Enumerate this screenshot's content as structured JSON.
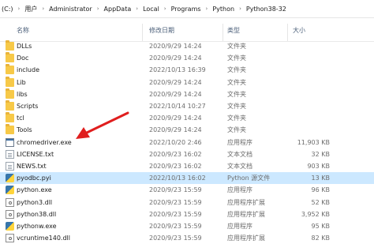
{
  "address_bar": {
    "crumbs": [
      "(C:)",
      "用户",
      "Administrator",
      "AppData",
      "Local",
      "Programs",
      "Python",
      "Python38-32"
    ]
  },
  "columns": {
    "name": "名称",
    "date": "修改日期",
    "type": "类型",
    "size": "大小"
  },
  "files": [
    {
      "name": "DLLs",
      "date": "2020/9/29 14:24",
      "type": "文件夹",
      "size": "",
      "icon": "folder-icon"
    },
    {
      "name": "Doc",
      "date": "2020/9/29 14:24",
      "type": "文件夹",
      "size": "",
      "icon": "folder-icon"
    },
    {
      "name": "include",
      "date": "2022/10/13 16:39",
      "type": "文件夹",
      "size": "",
      "icon": "folder-icon"
    },
    {
      "name": "Lib",
      "date": "2020/9/29 14:24",
      "type": "文件夹",
      "size": "",
      "icon": "folder-icon"
    },
    {
      "name": "libs",
      "date": "2020/9/29 14:24",
      "type": "文件夹",
      "size": "",
      "icon": "folder-icon"
    },
    {
      "name": "Scripts",
      "date": "2022/10/14 10:27",
      "type": "文件夹",
      "size": "",
      "icon": "folder-icon"
    },
    {
      "name": "tcl",
      "date": "2020/9/29 14:24",
      "type": "文件夹",
      "size": "",
      "icon": "folder-icon"
    },
    {
      "name": "Tools",
      "date": "2020/9/29 14:24",
      "type": "文件夹",
      "size": "",
      "icon": "folder-icon"
    },
    {
      "name": "chromedriver.exe",
      "date": "2022/10/20 2:46",
      "type": "应用程序",
      "size": "11,903 KB",
      "icon": "exe-icon"
    },
    {
      "name": "LICENSE.txt",
      "date": "2020/9/23 16:02",
      "type": "文本文档",
      "size": "32 KB",
      "icon": "text-file-icon"
    },
    {
      "name": "NEWS.txt",
      "date": "2020/9/23 16:02",
      "type": "文本文档",
      "size": "903 KB",
      "icon": "text-file-icon"
    },
    {
      "name": "pyodbc.pyi",
      "date": "2022/10/13 16:02",
      "type": "Python 源文件",
      "size": "13 KB",
      "icon": "python-file-icon",
      "selected": true
    },
    {
      "name": "python.exe",
      "date": "2020/9/23 15:59",
      "type": "应用程序",
      "size": "96 KB",
      "icon": "python-exe-icon"
    },
    {
      "name": "python3.dll",
      "date": "2020/9/23 15:59",
      "type": "应用程序扩展",
      "size": "52 KB",
      "icon": "dll-icon"
    },
    {
      "name": "python38.dll",
      "date": "2020/9/23 15:59",
      "type": "应用程序扩展",
      "size": "3,952 KB",
      "icon": "dll-icon"
    },
    {
      "name": "pythonw.exe",
      "date": "2020/9/23 15:59",
      "type": "应用程序",
      "size": "95 KB",
      "icon": "python-exe-icon"
    },
    {
      "name": "vcruntime140.dll",
      "date": "2020/9/23 15:59",
      "type": "应用程序扩展",
      "size": "82 KB",
      "icon": "dll-icon"
    }
  ],
  "annotation": {
    "color": "#e01e1e",
    "icon": "red-arrow-pointing-to-chromedriver"
  }
}
